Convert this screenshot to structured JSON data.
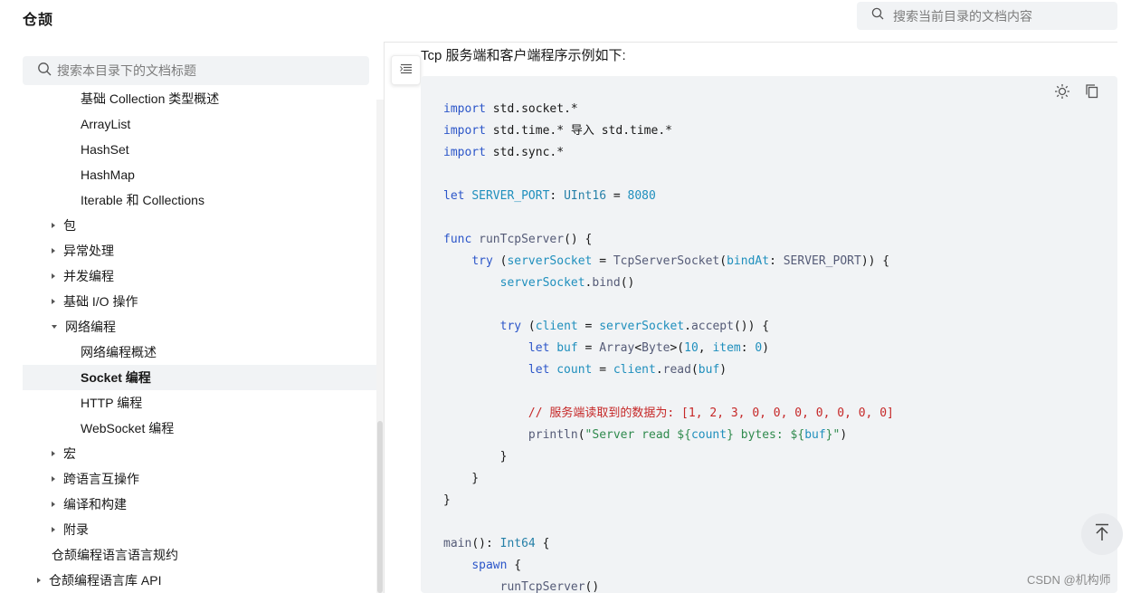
{
  "header": {
    "app_title": "仓颉",
    "search_placeholder": "搜索当前目录的文档内容"
  },
  "sidebar": {
    "search_placeholder": "搜索本目录下的文档标题",
    "items": [
      {
        "label": "基础 Collection 类型概述",
        "level": 2,
        "caret": "none"
      },
      {
        "label": "ArrayList",
        "level": 2,
        "caret": "none"
      },
      {
        "label": "HashSet",
        "level": 2,
        "caret": "none"
      },
      {
        "label": "HashMap",
        "level": 2,
        "caret": "none"
      },
      {
        "label": "Iterable 和 Collections",
        "level": 2,
        "caret": "none"
      },
      {
        "label": "包",
        "level": 1,
        "caret": "right"
      },
      {
        "label": "异常处理",
        "level": 1,
        "caret": "right"
      },
      {
        "label": "并发编程",
        "level": 1,
        "caret": "right"
      },
      {
        "label": "基础 I/O 操作",
        "level": 1,
        "caret": "right"
      },
      {
        "label": "网络编程",
        "level": 1,
        "caret": "down"
      },
      {
        "label": "网络编程概述",
        "level": 2,
        "caret": "none"
      },
      {
        "label": "Socket 编程",
        "level": 2,
        "caret": "none",
        "active": true
      },
      {
        "label": "HTTP 编程",
        "level": 2,
        "caret": "none"
      },
      {
        "label": "WebSocket 编程",
        "level": 2,
        "caret": "none"
      },
      {
        "label": "宏",
        "level": 1,
        "caret": "right"
      },
      {
        "label": "跨语言互操作",
        "level": 1,
        "caret": "right"
      },
      {
        "label": "编译和构建",
        "level": 1,
        "caret": "right"
      },
      {
        "label": "附录",
        "level": 1,
        "caret": "right"
      },
      {
        "label": "仓颉编程语言语言规约",
        "level": 0,
        "caret": "none"
      },
      {
        "label": "仓颉编程语言库 API",
        "level": 0,
        "caret": "right"
      }
    ]
  },
  "main": {
    "intro_text": "Tcp 服务端和客户端程序示例如下:"
  },
  "code": {
    "lines": [
      "import std.socket.*",
      "import std.time.* 导入 std.time.*",
      "import std.sync.*",
      "",
      "let SERVER_PORT: UInt16 = 8080",
      "",
      "func runTcpServer() {",
      "    try (serverSocket = TcpServerSocket(bindAt: SERVER_PORT)) {",
      "        serverSocket.bind()",
      "",
      "        try (client = serverSocket.accept()) {",
      "            let buf = Array<Byte>(10, item: 0)",
      "            let count = client.read(buf)",
      "",
      "            // 服务端读取到的数据为: [1, 2, 3, 0, 0, 0, 0, 0, 0, 0]",
      "            println(\"Server read ${count} bytes: ${buf}\")",
      "        }",
      "    }",
      "}",
      "",
      "main(): Int64 {",
      "    spawn {",
      "        runTcpServer()"
    ]
  },
  "icons": {
    "search": "search-icon",
    "toc": "toc-list-icon",
    "theme": "sun-icon",
    "copy": "copy-icon",
    "back_to_top": "arrow-up-icon"
  },
  "watermark": "CSDN @机构师"
}
